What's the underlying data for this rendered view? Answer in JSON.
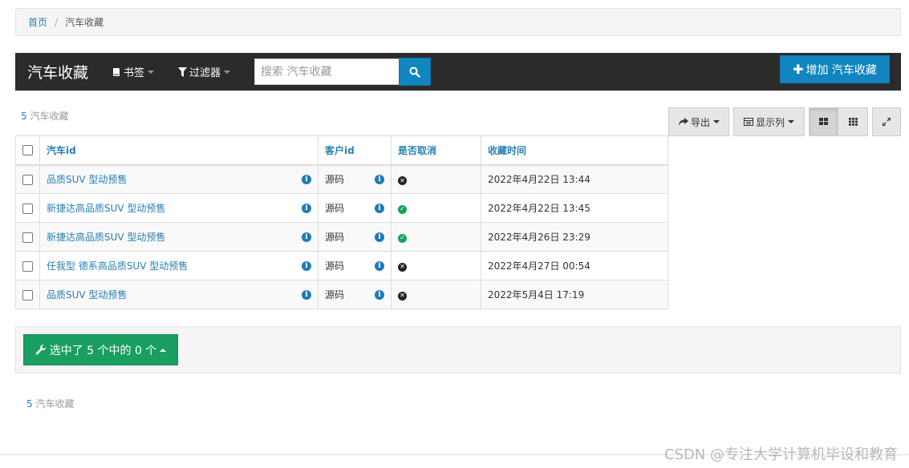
{
  "breadcrumb": {
    "home": "首页",
    "separator": "/",
    "current": "汽车收藏"
  },
  "navbar": {
    "brand": "汽车收藏",
    "bookmarks_label": "书签",
    "filter_label": "过滤器",
    "search_placeholder": "搜索 汽车收藏",
    "add_label": "增加 汽车收藏"
  },
  "summary": {
    "count": "5",
    "label": "汽车收藏"
  },
  "toolbar": {
    "export_label": "导出",
    "columns_label": "显示列"
  },
  "table": {
    "columns": [
      "汽车id",
      "客户id",
      "是否取消",
      "收藏时间"
    ],
    "rows": [
      {
        "car": "品质SUV 型动预售",
        "customer": "源码",
        "cancelled": false,
        "time": "2022年4月22日 13:44"
      },
      {
        "car": "新捷达高品质SUV 型动预售",
        "customer": "源码",
        "cancelled": true,
        "time": "2022年4月22日 13:45"
      },
      {
        "car": "新捷达高品质SUV 型动预售",
        "customer": "源码",
        "cancelled": true,
        "time": "2022年4月26日 23:29"
      },
      {
        "car": "任我型 德系高品质SUV 型动预售",
        "customer": "源码",
        "cancelled": false,
        "time": "2022年4月27日 00:54"
      },
      {
        "car": "品质SUV 型动预售",
        "customer": "源码",
        "cancelled": false,
        "time": "2022年5月4日 17:19"
      }
    ]
  },
  "action": {
    "label": "选中了 5 个中的 0 个"
  },
  "watermark": "CSDN @专注大学计算机毕设和教育",
  "colors": {
    "primary": "#1185bf",
    "success": "#1a9e62",
    "navbar": "#2b2b2b",
    "link": "#2a7fb4"
  }
}
